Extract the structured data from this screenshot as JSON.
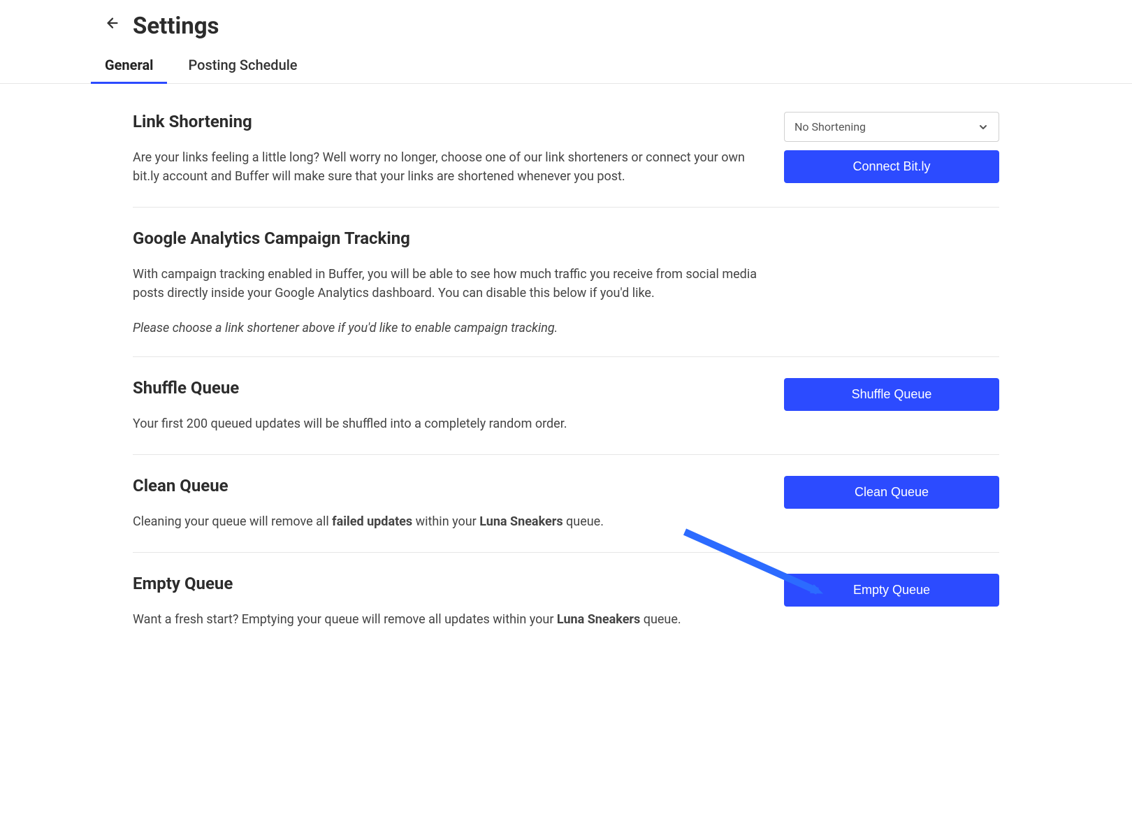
{
  "header": {
    "title": "Settings",
    "tabs": [
      {
        "label": "General",
        "active": true
      },
      {
        "label": "Posting Schedule",
        "active": false
      }
    ]
  },
  "sections": {
    "link_shortening": {
      "title": "Link Shortening",
      "desc": "Are your links feeling a little long? Well worry no longer, choose one of our link shorteners or connect your own bit.ly account and Buffer will make sure that your links are shortened whenever you post.",
      "select_value": "No Shortening",
      "connect_button": "Connect Bit.ly"
    },
    "ga_tracking": {
      "title": "Google Analytics Campaign Tracking",
      "desc": "With campaign tracking enabled in Buffer, you will be able to see how much traffic you receive from social media posts directly inside your Google Analytics dashboard. You can disable this below if you'd like.",
      "note": "Please choose a link shortener above if you'd like to enable campaign tracking."
    },
    "shuffle_queue": {
      "title": "Shuffle Queue",
      "desc": "Your first 200 queued updates will be shuffled into a completely random order.",
      "button": "Shuffle Queue"
    },
    "clean_queue": {
      "title": "Clean Queue",
      "desc_pre": "Cleaning your queue will remove all ",
      "desc_strong1": "failed updates",
      "desc_mid": " within your ",
      "desc_strong2": "Luna Sneakers",
      "desc_post": " queue.",
      "button": "Clean Queue"
    },
    "empty_queue": {
      "title": "Empty Queue",
      "desc_pre": "Want a fresh start? Emptying your queue will remove all updates within your ",
      "desc_strong": "Luna Sneakers",
      "desc_post": " queue.",
      "button": "Empty Queue"
    }
  }
}
